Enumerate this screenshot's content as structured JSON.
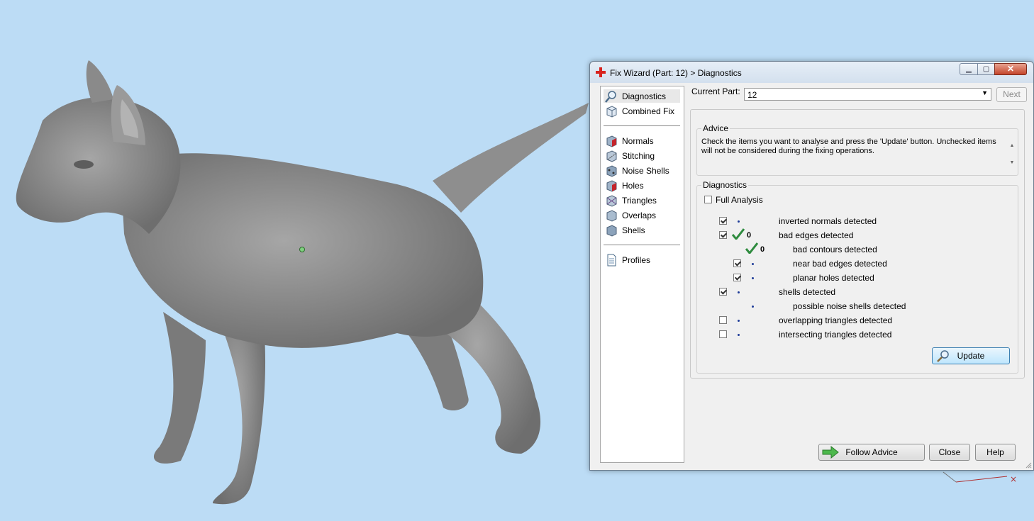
{
  "window": {
    "title": "Fix Wizard (Part: 12) > Diagnostics",
    "minimize_icon": "minimize-icon",
    "maximize_icon": "maximize-icon",
    "close_icon": "close-icon"
  },
  "nav": {
    "items": [
      {
        "label": "Diagnostics",
        "icon": "magnifier-icon",
        "selected": true
      },
      {
        "label": "Combined Fix",
        "icon": "cube-icon"
      },
      {
        "label": "Normals",
        "icon": "cube-icon"
      },
      {
        "label": "Stitching",
        "icon": "cube-icon"
      },
      {
        "label": "Noise Shells",
        "icon": "cube-icon"
      },
      {
        "label": "Holes",
        "icon": "cube-icon"
      },
      {
        "label": "Triangles",
        "icon": "cube-icon"
      },
      {
        "label": "Overlaps",
        "icon": "cube-icon"
      },
      {
        "label": "Shells",
        "icon": "cube-icon"
      },
      {
        "label": "Profiles",
        "icon": "document-icon"
      }
    ]
  },
  "current_part": {
    "label": "Current Part:",
    "value": "12",
    "next_label": "Next"
  },
  "advice": {
    "title": "Advice",
    "text": "Check the items you want to analyse and press the 'Update' button. Unchecked items will not be considered during the fixing operations."
  },
  "diagnostics": {
    "title": "Diagnostics",
    "full_analysis_label": "Full Analysis",
    "full_analysis_checked": false,
    "rows": [
      {
        "label": "inverted normals detected",
        "checked": true
      },
      {
        "label": "bad edges detected",
        "checked": true,
        "ok": true,
        "count": "0"
      },
      {
        "label": "bad contours detected",
        "ok": true,
        "count": "0"
      },
      {
        "label": "near bad edges detected",
        "checked": true
      },
      {
        "label": "planar holes detected",
        "checked": true
      },
      {
        "label": "shells detected",
        "checked": true
      },
      {
        "label": "possible noise shells detected"
      },
      {
        "label": "overlapping triangles detected",
        "checked": false
      },
      {
        "label": "intersecting triangles detected",
        "checked": false
      }
    ],
    "update_label": "Update"
  },
  "buttons": {
    "follow_advice": "Follow Advice",
    "close": "Close",
    "help": "Help"
  },
  "colors": {
    "viewport_bg": "#bcdcf5",
    "model_gray": "#8c8c8c",
    "check_green": "#2e8b3e",
    "dot_blue": "#1f3d99"
  }
}
